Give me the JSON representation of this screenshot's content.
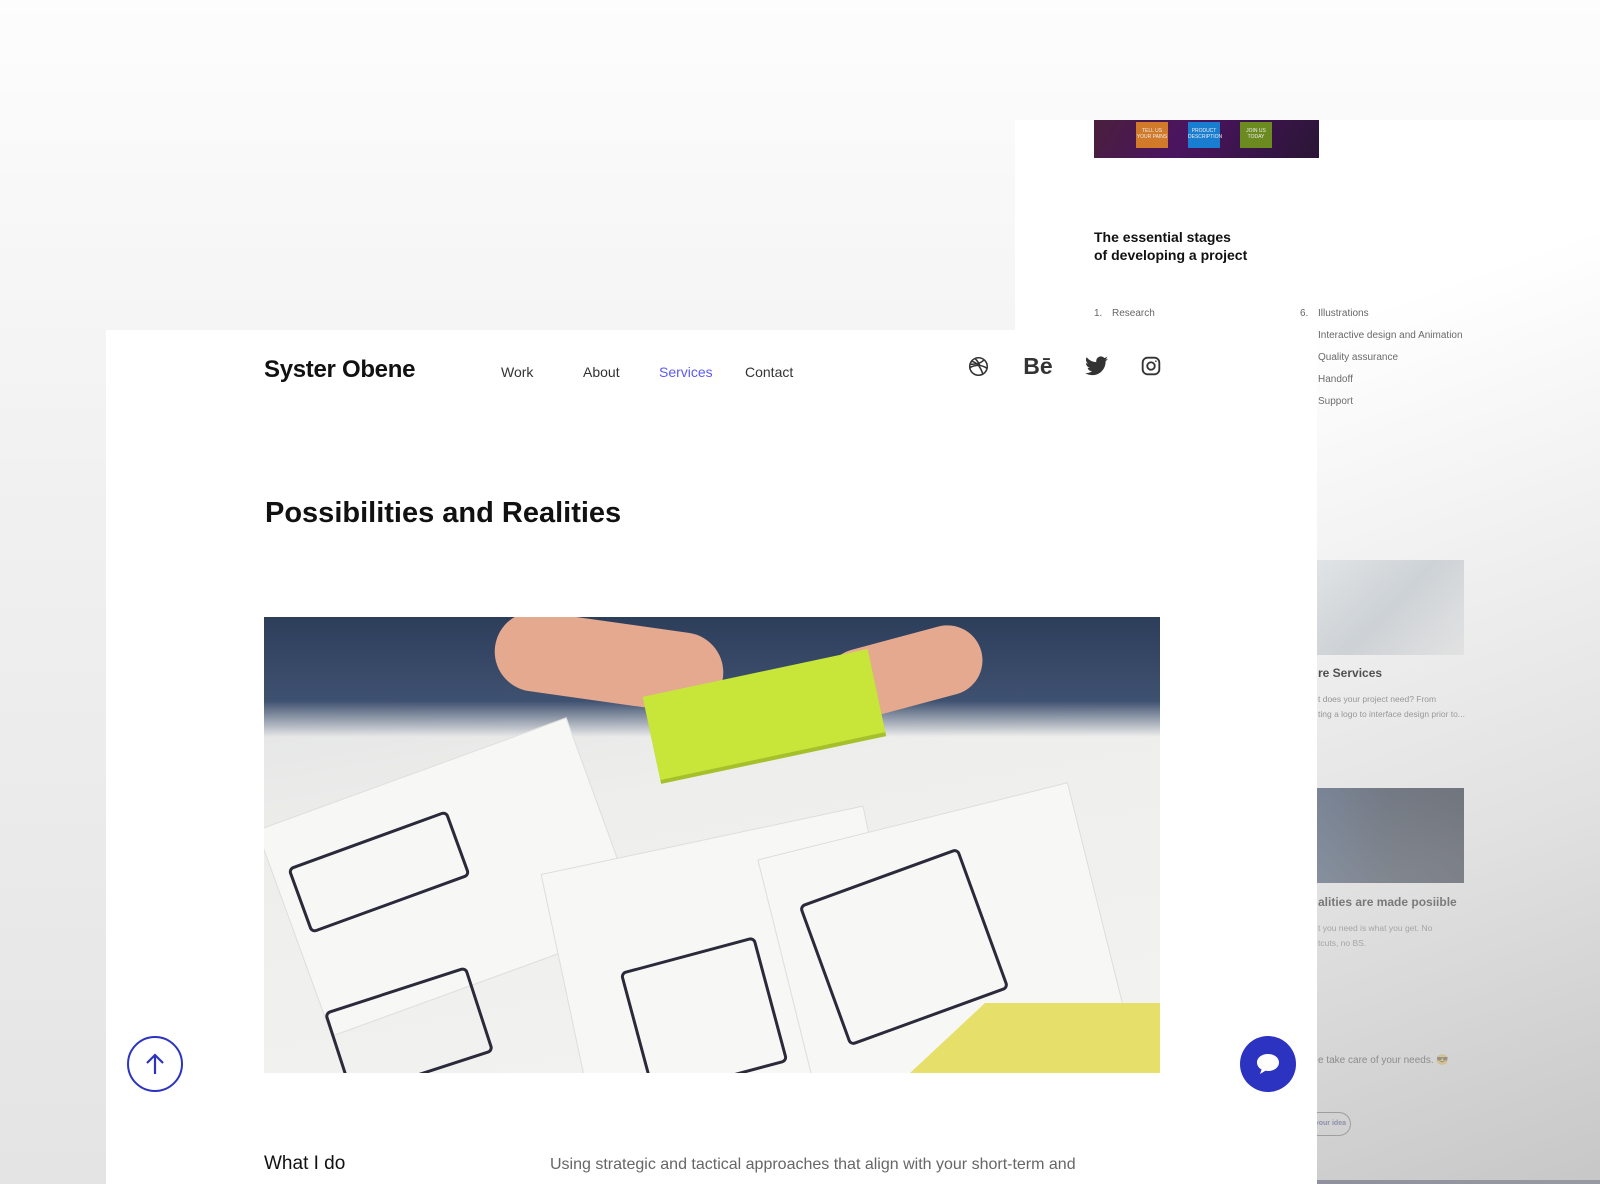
{
  "back_page": {
    "banner_steps": [
      "TELL US YOUR PAINS",
      "PRODUCT DESCRIPTION",
      "JOIN US TODAY"
    ],
    "stages_title_line1": "The essential stages",
    "stages_title_line2": "of developing a project",
    "stages": [
      {
        "num": "1.",
        "label": "Research"
      },
      {
        "num": "6.",
        "label": "Illustrations"
      },
      {
        "num": "",
        "label": "Interactive design and Animation"
      },
      {
        "num": "",
        "label": "Quality assurance"
      },
      {
        "num": "",
        "label": "Handoff"
      },
      {
        "num": "",
        "label": "Support"
      }
    ],
    "cards": [
      {
        "title": "re Services",
        "text_line1": "t does your project need? From",
        "text_line2": "ting a logo to interface design prior to..."
      },
      {
        "title": "alities are made posiible",
        "text_line1": "t you need is what you get. No",
        "text_line2": "tcuts, no BS."
      }
    ],
    "tagline": "e take care of your needs. 😎",
    "cta": "ut your idea"
  },
  "header": {
    "logo": "Syster Obene",
    "nav": [
      {
        "label": "Work",
        "active": false
      },
      {
        "label": "About",
        "active": false
      },
      {
        "label": "Services",
        "active": true
      },
      {
        "label": "Contact",
        "active": false
      }
    ],
    "social_icons": [
      "dribbble-icon",
      "behance-icon",
      "twitter-icon",
      "instagram-icon"
    ],
    "behance_text": "Bē"
  },
  "main": {
    "title": "Possibilities and Realities",
    "section_label": "What I do",
    "section_text": "Using strategic and tactical approaches that align with your short-term and"
  },
  "colors": {
    "accent": "#2c33c0",
    "nav_active": "#5b5bf0"
  }
}
